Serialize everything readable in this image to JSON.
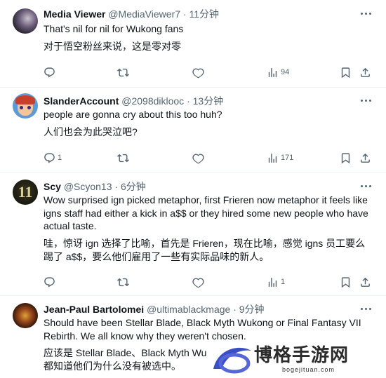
{
  "tweets": [
    {
      "name": "Media Viewer",
      "handle": "@MediaViewer7",
      "sep": "·",
      "time": "11分钟",
      "text1": "That's nil for nil for Wukong fans",
      "text2": "对于悟空粉丝来说，这是零对零",
      "replies": "",
      "views": "94"
    },
    {
      "name": "SlanderAccount",
      "handle": "@2098diklooc",
      "sep": "·",
      "time": "13分钟",
      "text1": "people are gonna cry about this too huh?",
      "text2": "人们也会为此哭泣吧?",
      "replies": "1",
      "views": "171"
    },
    {
      "name": "Scy",
      "handle": "@Scyon13",
      "sep": "·",
      "time": "6分钟",
      "text1": "Wow surprised ign picked metaphor, first Frieren now metaphor it feels like igns staff had either a kick in a$$ or they hired some new people who have actual taste.",
      "text2": "哇，惊讶 ign 选择了比喻，首先是 Frieren，现在比喻，感觉 igns 员工要么踢了 a$$，要么他们雇用了一些有实际品味的新人。",
      "replies": "",
      "views": "1"
    },
    {
      "name": "Jean-Paul Bartolomei",
      "handle": "@ultimablackmage",
      "sep": "·",
      "time": "9分钟",
      "text1": "Should have been Stellar Blade, Black Myth Wukong or Final Fantasy VII Rebirth. We all know why they weren't chosen.",
      "text2": "应该是 Stellar Blade、Black Myth Wu",
      "text3": "都知道他们为什么没有被选中。",
      "replies": "",
      "views": ""
    }
  ],
  "watermark": {
    "title": "博格手游网",
    "url": "bogejituan.com"
  },
  "icons": [
    "more-icon",
    "reply-icon",
    "retweet-icon",
    "like-icon",
    "views-icon",
    "bookmark-icon",
    "share-icon"
  ]
}
